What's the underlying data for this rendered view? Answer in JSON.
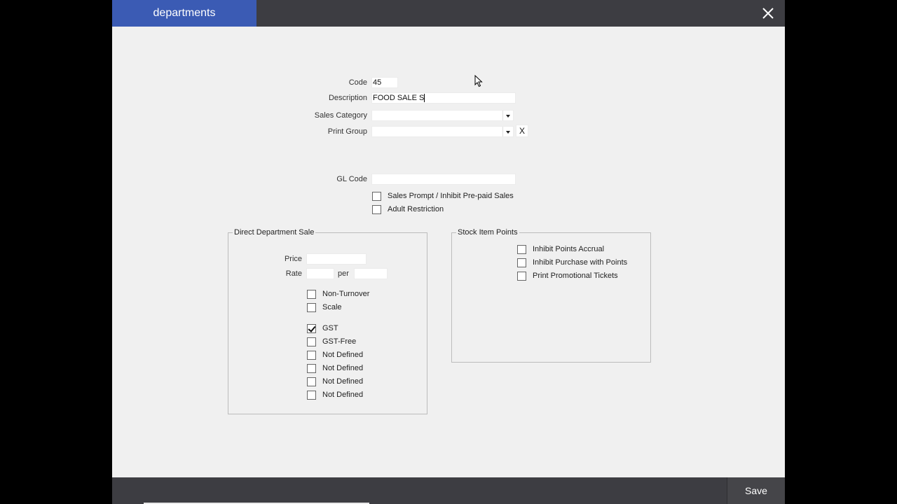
{
  "window": {
    "title": "departments"
  },
  "form": {
    "code": {
      "label": "Code",
      "value": "45"
    },
    "description": {
      "label": "Description",
      "value": "FOOD SALE S"
    },
    "sales_category": {
      "label": "Sales Category",
      "value": ""
    },
    "print_group": {
      "label": "Print Group",
      "value": "",
      "clear_label": "X"
    },
    "gl_code": {
      "label": "GL Code",
      "value": ""
    },
    "options": [
      {
        "label": "Sales Prompt / Inhibit Pre-paid Sales",
        "checked": false
      },
      {
        "label": "Adult Restriction",
        "checked": false
      }
    ]
  },
  "direct_department_sale": {
    "title": "Direct Department Sale",
    "price_label": "Price",
    "price_value": "",
    "rate_label": "Rate",
    "rate_value": "",
    "per_label": "per",
    "per_value": "",
    "flags": [
      {
        "label": "Non-Turnover",
        "checked": false
      },
      {
        "label": "Scale",
        "checked": false
      }
    ],
    "tax": [
      {
        "label": "GST",
        "checked": true
      },
      {
        "label": "GST-Free",
        "checked": false
      },
      {
        "label": "Not Defined",
        "checked": false
      },
      {
        "label": "Not Defined",
        "checked": false
      },
      {
        "label": "Not Defined",
        "checked": false
      },
      {
        "label": "Not Defined",
        "checked": false
      }
    ]
  },
  "stock_item_points": {
    "title": "Stock Item Points",
    "options": [
      {
        "label": "Inhibit Points Accrual",
        "checked": false
      },
      {
        "label": "Inhibit Purchase with Points",
        "checked": false
      },
      {
        "label": "Print Promotional Tickets",
        "checked": false
      }
    ]
  },
  "footer": {
    "save_label": "Save"
  },
  "icons": {
    "close": "close-icon",
    "cursor": "mouse-pointer-icon",
    "dropdown": "chevron-down-icon"
  },
  "colors": {
    "title_tab": "#3b5bb4",
    "bar": "#3d3d42",
    "window_bg": "#f0f0f0"
  }
}
